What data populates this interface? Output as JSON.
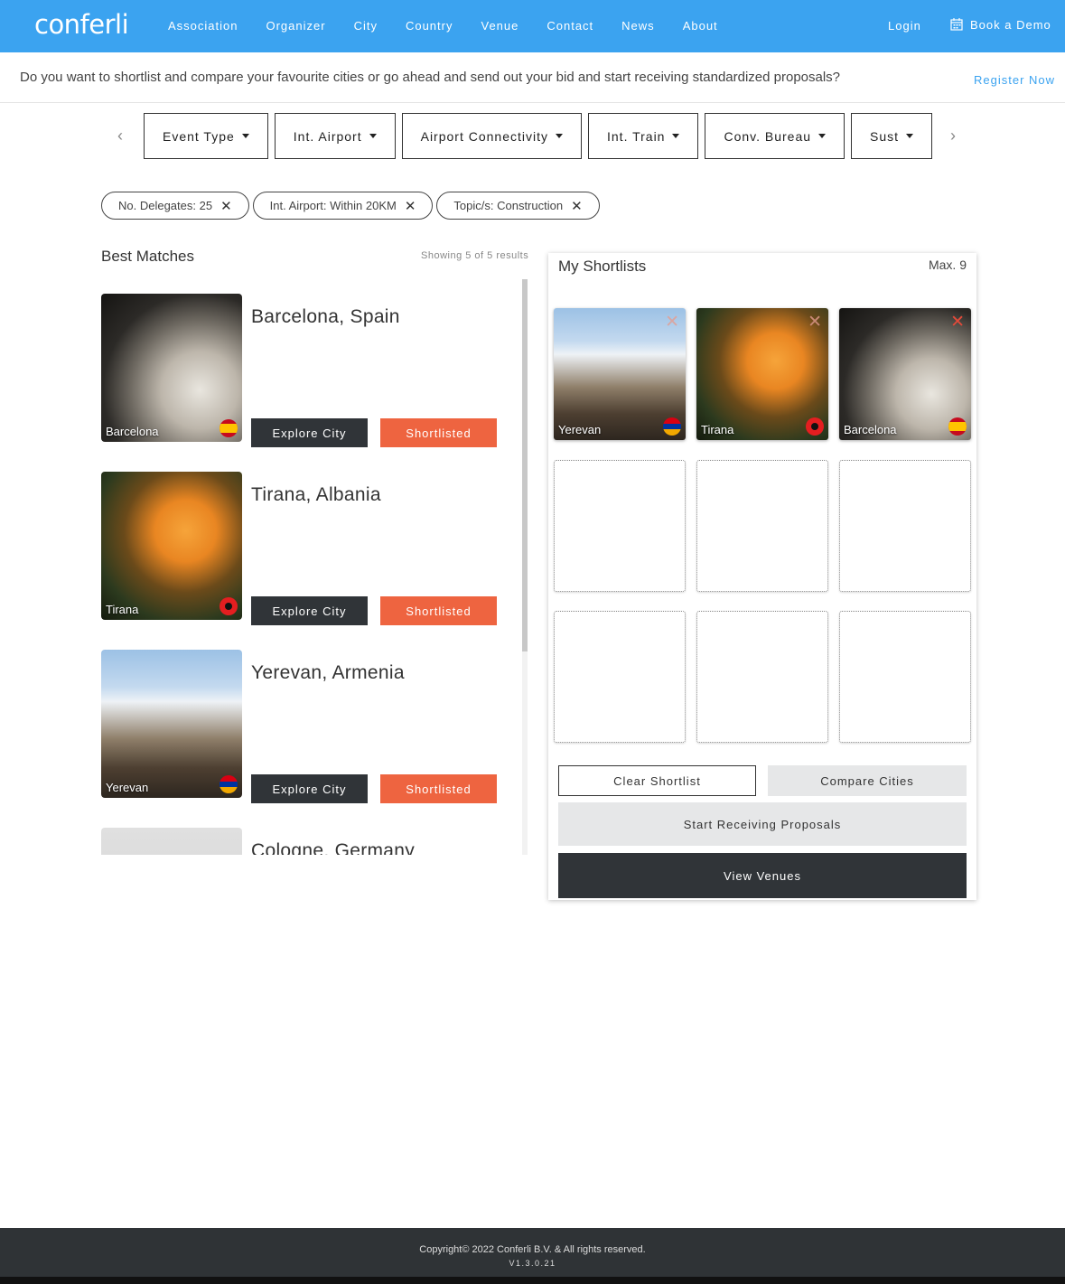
{
  "nav": {
    "logo": "conferli",
    "links": [
      "Association",
      "Organizer",
      "City",
      "Country",
      "Venue",
      "Contact",
      "News",
      "About"
    ],
    "login": "Login",
    "book_demo": "Book a Demo"
  },
  "banner": {
    "text": "Do you want to shortlist and compare your favourite cities or go ahead and send out your bid and start receiving standardized proposals?",
    "register": "Register Now"
  },
  "filters": [
    "Event Type",
    "Int. Airport",
    "Airport Connectivity",
    "Int. Train",
    "Conv. Bureau",
    "Sust"
  ],
  "chips": [
    "No. Delegates: 25",
    "Int. Airport: Within 20KM",
    "Topic/s: Construction"
  ],
  "results": {
    "title": "Best Matches",
    "showing": "Showing 5 of 5 results",
    "explore_label": "Explore City",
    "shortlisted_label": "Shortlisted",
    "items": [
      {
        "name": "Barcelona, Spain",
        "label": "Barcelona"
      },
      {
        "name": "Tirana, Albania",
        "label": "Tirana"
      },
      {
        "name": "Yerevan, Armenia",
        "label": "Yerevan"
      },
      {
        "name": "Cologne, Germany",
        "label": ""
      }
    ]
  },
  "shortlist": {
    "title": "My Shortlists",
    "max": "Max. 9",
    "cities": [
      "Yerevan",
      "Tirana",
      "Barcelona"
    ],
    "clear": "Clear Shortlist",
    "compare": "Compare Cities",
    "proposals": "Start Receiving Proposals",
    "venues": "View Venues"
  },
  "footer": {
    "copyright": "Copyright© 2022 Conferli B.V. & All rights reserved.",
    "version": "V1.3.0.21"
  },
  "colors": {
    "brand_blue": "#3ba3f0",
    "accent_orange": "#ee6440",
    "dark": "#303438"
  }
}
